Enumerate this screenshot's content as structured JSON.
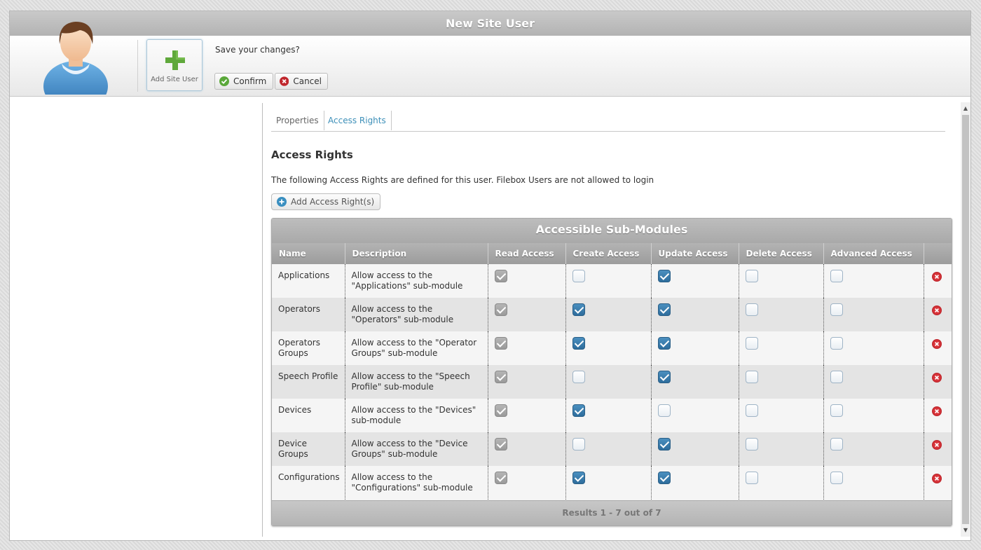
{
  "window": {
    "title": "New Site User"
  },
  "toolbar": {
    "add_label": "Add Site User",
    "prompt": "Save your changes?",
    "confirm_label": "Confirm",
    "cancel_label": "Cancel"
  },
  "tabs": [
    {
      "label": "Properties",
      "active": false
    },
    {
      "label": "Access Rights",
      "active": true
    }
  ],
  "section": {
    "title": "Access Rights",
    "description": "The following Access Rights are defined for this user. Filebox Users are not allowed to login",
    "add_button": "Add Access Right(s)"
  },
  "grid": {
    "title": "Accessible Sub-Modules",
    "columns": [
      "Name",
      "Description",
      "Read Access",
      "Create Access",
      "Update Access",
      "Delete Access",
      "Advanced Access",
      ""
    ],
    "rows": [
      {
        "name": "Applications",
        "description": "Allow access to the \"Applications\" sub-module",
        "read": true,
        "create": false,
        "update": true,
        "delete": false,
        "advanced": false
      },
      {
        "name": "Operators",
        "description": "Allow access to the \"Operators\" sub-module",
        "read": true,
        "create": true,
        "update": true,
        "delete": false,
        "advanced": false
      },
      {
        "name": "Operators Groups",
        "description": "Allow access to the \"Operator Groups\" sub-module",
        "read": true,
        "create": true,
        "update": true,
        "delete": false,
        "advanced": false
      },
      {
        "name": "Speech Profile",
        "description": "Allow access to the \"Speech Profile\" sub-module",
        "read": true,
        "create": false,
        "update": true,
        "delete": false,
        "advanced": false
      },
      {
        "name": "Devices",
        "description": "Allow access to the \"Devices\" sub-module",
        "read": true,
        "create": true,
        "update": false,
        "delete": false,
        "advanced": false
      },
      {
        "name": "Device Groups",
        "description": "Allow access to the \"Device Groups\" sub-module",
        "read": true,
        "create": false,
        "update": true,
        "delete": false,
        "advanced": false
      },
      {
        "name": "Configurations",
        "description": "Allow access to the \"Configurations\" sub-module",
        "read": true,
        "create": true,
        "update": true,
        "delete": false,
        "advanced": false
      }
    ],
    "footer": "Results 1 - 7 out of 7"
  },
  "colors": {
    "accent": "#3c8fb8",
    "checked": "#2d6d9c",
    "read_locked": "#9a9a9a",
    "delete": "#c0272d",
    "confirm": "#5aa83a"
  },
  "icons": {
    "avatar": "user-avatar",
    "add": "green-plus-icon",
    "confirm": "check-circle-icon",
    "cancel": "x-circle-icon",
    "add_right": "plus-circle-icon",
    "delete": "delete-circle-icon"
  }
}
